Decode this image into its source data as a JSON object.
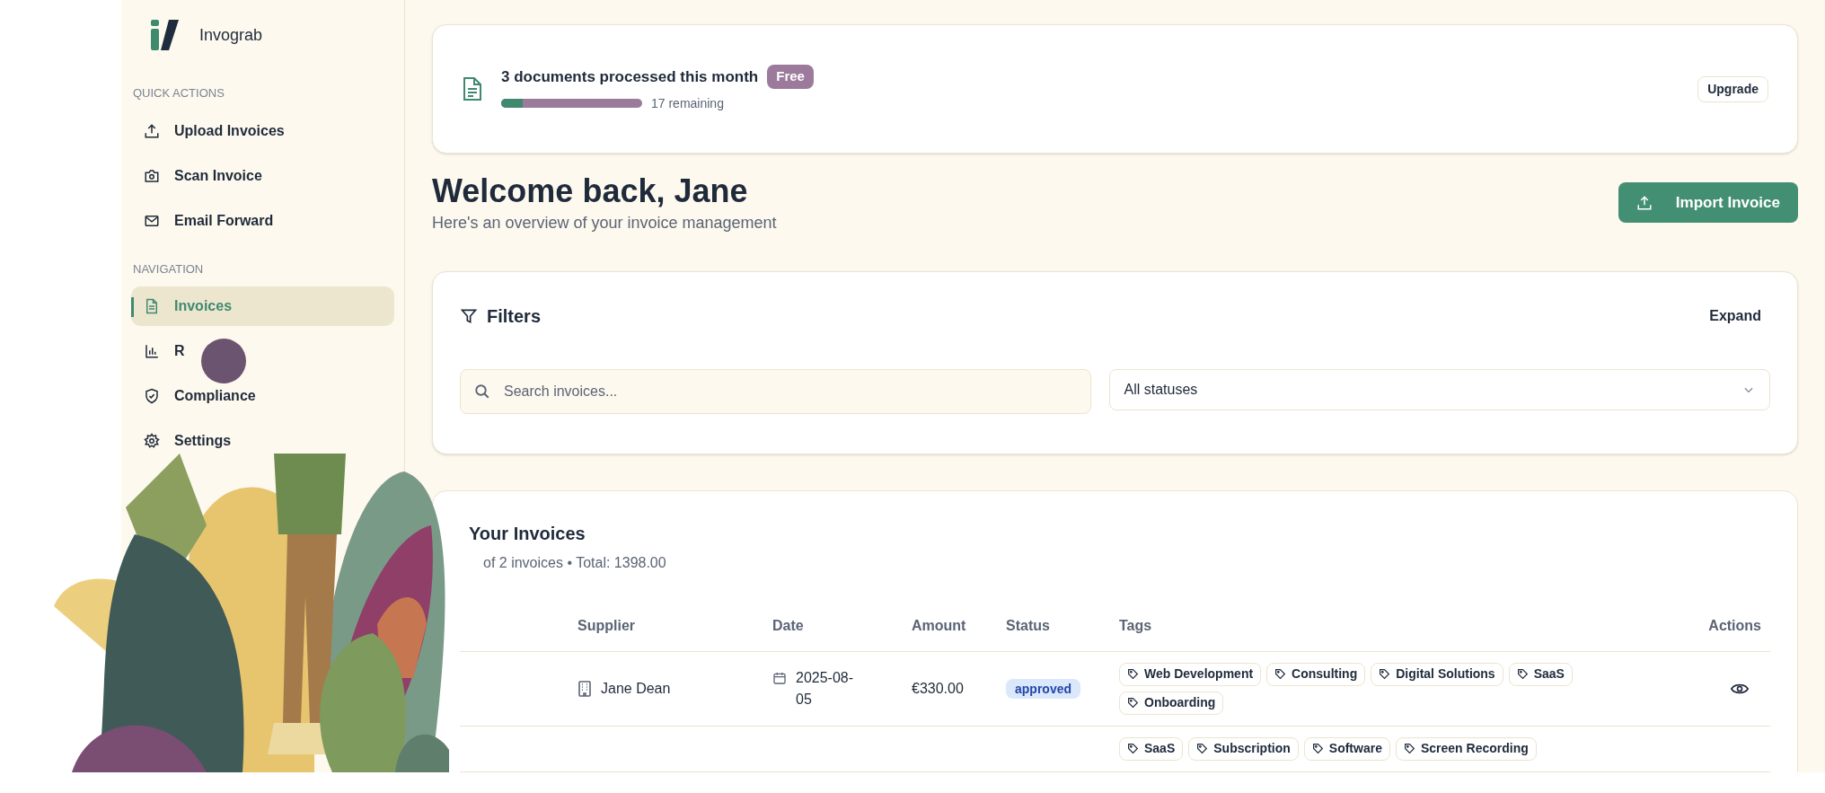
{
  "app": {
    "name": "Invograb"
  },
  "sidebar": {
    "sections": [
      {
        "title": "QUICK ACTIONS",
        "items": [
          {
            "label": "Upload Invoices",
            "selected": false
          },
          {
            "label": "Scan Invoice",
            "selected": false
          },
          {
            "label": "Email Forward",
            "selected": false
          }
        ]
      },
      {
        "title": "NAVIGATION",
        "items": [
          {
            "label": "Invoices",
            "selected": true
          },
          {
            "label": "R",
            "selected": false
          },
          {
            "label": "Compliance",
            "selected": false
          },
          {
            "label": "Settings",
            "selected": false
          }
        ]
      }
    ]
  },
  "usage": {
    "text": "3 documents processed this month",
    "plan": "Free",
    "level": 0.15,
    "remaining": "17 remaining",
    "button": "Upgrade"
  },
  "header": {
    "title": "Welcome back, Jane",
    "subtitle": "Here's an overview of your invoice management",
    "button": "Import Invoice"
  },
  "filters": {
    "title": "Filters",
    "toggle": "Expand",
    "search": {
      "placeholder": "Search invoices..."
    },
    "status_select": {
      "value": "All statuses"
    }
  },
  "invoices": {
    "title": "Your Invoices",
    "subtitle": "of 2 invoices • Total: 1398.00",
    "columns": [
      "Supplier",
      "Date",
      "Amount",
      "Status",
      "Tags",
      "Actions"
    ],
    "rows": [
      {
        "supplier": "Jane Dean",
        "date": "2025-08-05",
        "amount": "€330.00",
        "status": "approved",
        "tags": [
          "Web Development",
          "Consulting",
          "Digital Solutions",
          "SaaS",
          "Onboarding"
        ]
      },
      {
        "tags": [
          "SaaS",
          "Subscription",
          "Software",
          "Screen Recording"
        ]
      }
    ]
  }
}
